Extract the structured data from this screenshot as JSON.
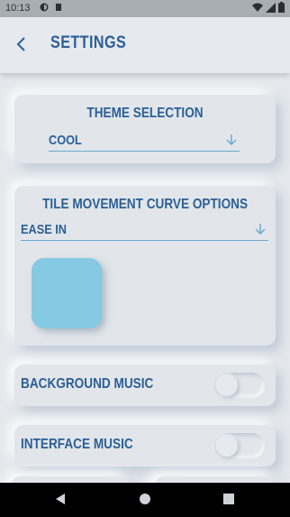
{
  "status_bar": {
    "time": "10:13"
  },
  "appbar": {
    "title": "SETTINGS"
  },
  "theme": {
    "heading": "THEME SELECTION",
    "value": "COOL"
  },
  "tile_curve": {
    "heading": "TILE MOVEMENT CURVE OPTIONS",
    "value": "EASE IN",
    "preview_color": "#86c9e2"
  },
  "background_music": {
    "label": "BACKGROUND MUSIC",
    "enabled": false
  },
  "interface_music": {
    "label": "INTERFACE MUSIC",
    "enabled": false
  },
  "colors": {
    "accent": "#2b5f96",
    "underline": "#6ea8cf",
    "background": "#e4e8ec"
  }
}
